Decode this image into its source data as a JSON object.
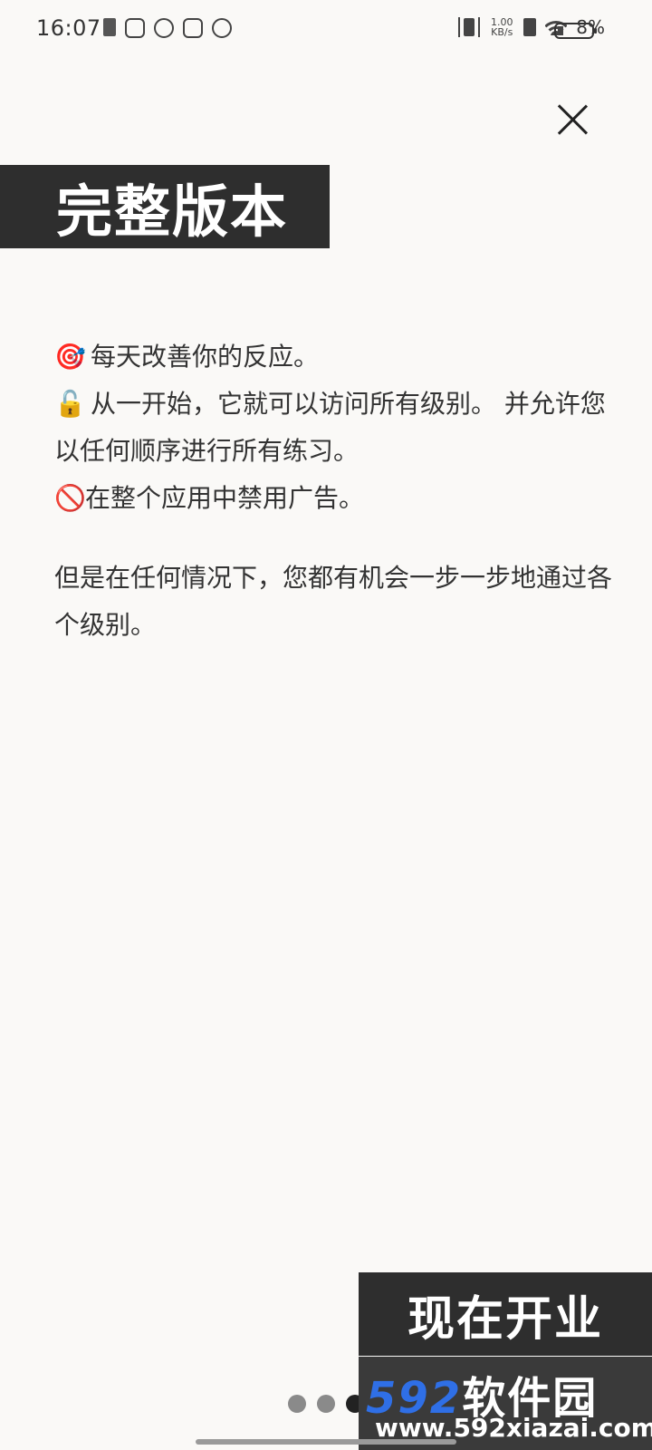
{
  "status_bar": {
    "time": "16:07",
    "net_speed_value": "1.00",
    "net_speed_unit": "KB/s",
    "battery_percent": "8%"
  },
  "title": "完整版本",
  "features": [
    {
      "icon": "🎯",
      "text": "每天改善你的反应。"
    },
    {
      "icon": "🔓",
      "text": "从一开始，它就可以访问所有级别。 并允许您以任何顺序进行所有练习。"
    },
    {
      "icon": "🚫",
      "text": "在整个应用中禁用广告。"
    }
  ],
  "note": "但是在任何情况下，您都有机会一步一步地通过各个级别。",
  "start_button_label": "现在开业",
  "pagination": {
    "total": 3,
    "active_index": 2
  },
  "watermark": {
    "brand_number": "592",
    "brand_name": "软件园",
    "url": "www.592xiazai.com"
  }
}
